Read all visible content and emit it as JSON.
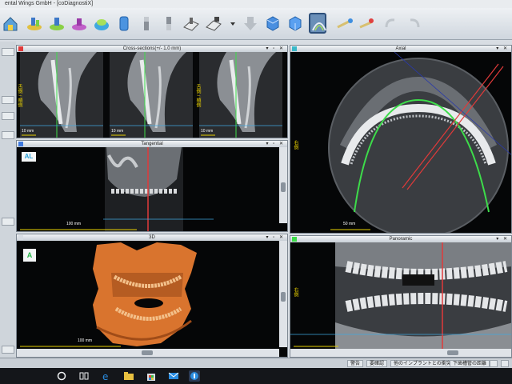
{
  "window": {
    "title": "ental Wings GmbH - [coDiagnostiX]"
  },
  "toolbar": {
    "icons": [
      "home-icon",
      "implant-plan-icon",
      "implant-plan-2-icon",
      "drill-sleeve-icon",
      "abutment-icon",
      "cylinder-icon",
      "bone-filter-icon",
      "bone-filter-2-icon",
      "guide-icon",
      "guide-export-icon",
      "dropdown-icon",
      "arrow-down-icon",
      "cube-front-icon",
      "cube-side-icon",
      "panoramic-view-icon",
      "measure-icon",
      "annotation-icon",
      "undo-icon",
      "redo-icon"
    ]
  },
  "panels": {
    "cross": {
      "title": "Cross-sections(+/- 1.0 mm)",
      "scale": "10 mm",
      "side_label": "舌側 / 頬側"
    },
    "axial": {
      "title": "Axial",
      "scale": "50 mm",
      "side_label": "右側"
    },
    "tangential": {
      "title": "Tangential",
      "scale": "100 mm",
      "badge": "AL"
    },
    "view3d": {
      "title": "3D",
      "scale": "100 mm",
      "badge": "A"
    },
    "panoramic": {
      "title": "Panoramic",
      "side_label": "右側"
    }
  },
  "colors": {
    "accent_red": "#e03a3a",
    "accent_green": "#3ddc4a",
    "accent_yellow": "#e8d000",
    "accent_cyan": "#3fa8e0",
    "bone_3d": "#d9742e"
  },
  "statusbar": {
    "items": [
      "警告",
      "要確認",
      "他のインプラントとの衝突",
      "下歯槽管の距離"
    ],
    "icons": [
      "grid-icon",
      "lock-icon"
    ]
  },
  "taskbar": {
    "icons": [
      "start-icon",
      "search-icon",
      "task-view-icon",
      "edge-icon",
      "explorer-icon",
      "store-icon",
      "mail-icon",
      "app-icon"
    ]
  }
}
